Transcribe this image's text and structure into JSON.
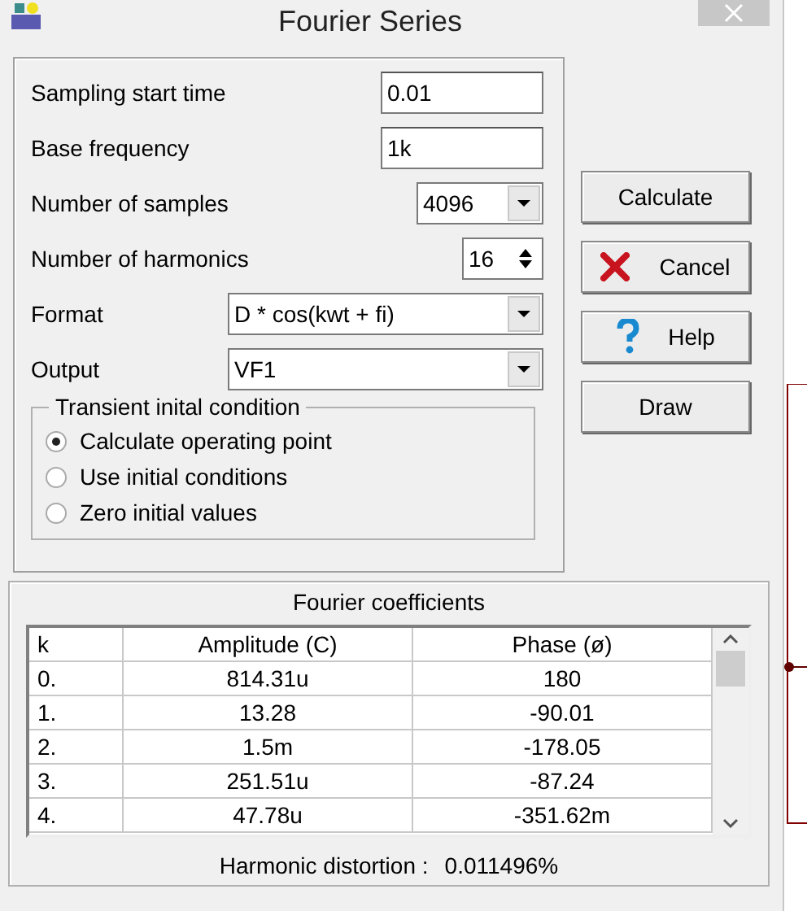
{
  "window": {
    "title": "Fourier Series"
  },
  "fields": [
    {
      "kind": "text",
      "label": "Sampling start time",
      "value": "0.01"
    },
    {
      "kind": "text",
      "label": "Base frequency",
      "value": "1k"
    },
    {
      "kind": "dropdown",
      "label": "Number of samples",
      "value": "4096"
    },
    {
      "kind": "spin",
      "label": "Number of harmonics",
      "value": "16"
    },
    {
      "kind": "wide-dropdown",
      "label": "Format",
      "value": "D * cos(kwt + fi)"
    },
    {
      "kind": "wide-dropdown",
      "label": "Output",
      "value": "VF1"
    }
  ],
  "transient": {
    "title": "Transient inital condition",
    "options": [
      {
        "label": "Calculate operating point",
        "selected": true
      },
      {
        "label": "Use initial conditions",
        "selected": false
      },
      {
        "label": "Zero initial values",
        "selected": false
      }
    ]
  },
  "buttons": [
    {
      "kind": "plain",
      "label": "Calculate"
    },
    {
      "kind": "cancel",
      "label": "Cancel"
    },
    {
      "kind": "help",
      "label": "Help"
    },
    {
      "kind": "plain",
      "label": "Draw"
    }
  ],
  "coefficients": {
    "title": "Fourier coefficients",
    "columns": [
      "k",
      "Amplitude (C)",
      "Phase (ø)"
    ],
    "rows": [
      [
        "0.",
        "814.31u",
        "180"
      ],
      [
        "1.",
        "13.28",
        "-90.01"
      ],
      [
        "2.",
        "1.5m",
        "-178.05"
      ],
      [
        "3.",
        "251.51u",
        "-87.24"
      ],
      [
        "4.",
        "47.78u",
        "-351.62m"
      ]
    ],
    "distortion_label": "Harmonic distortion :",
    "distortion_value": "0.011496%"
  }
}
